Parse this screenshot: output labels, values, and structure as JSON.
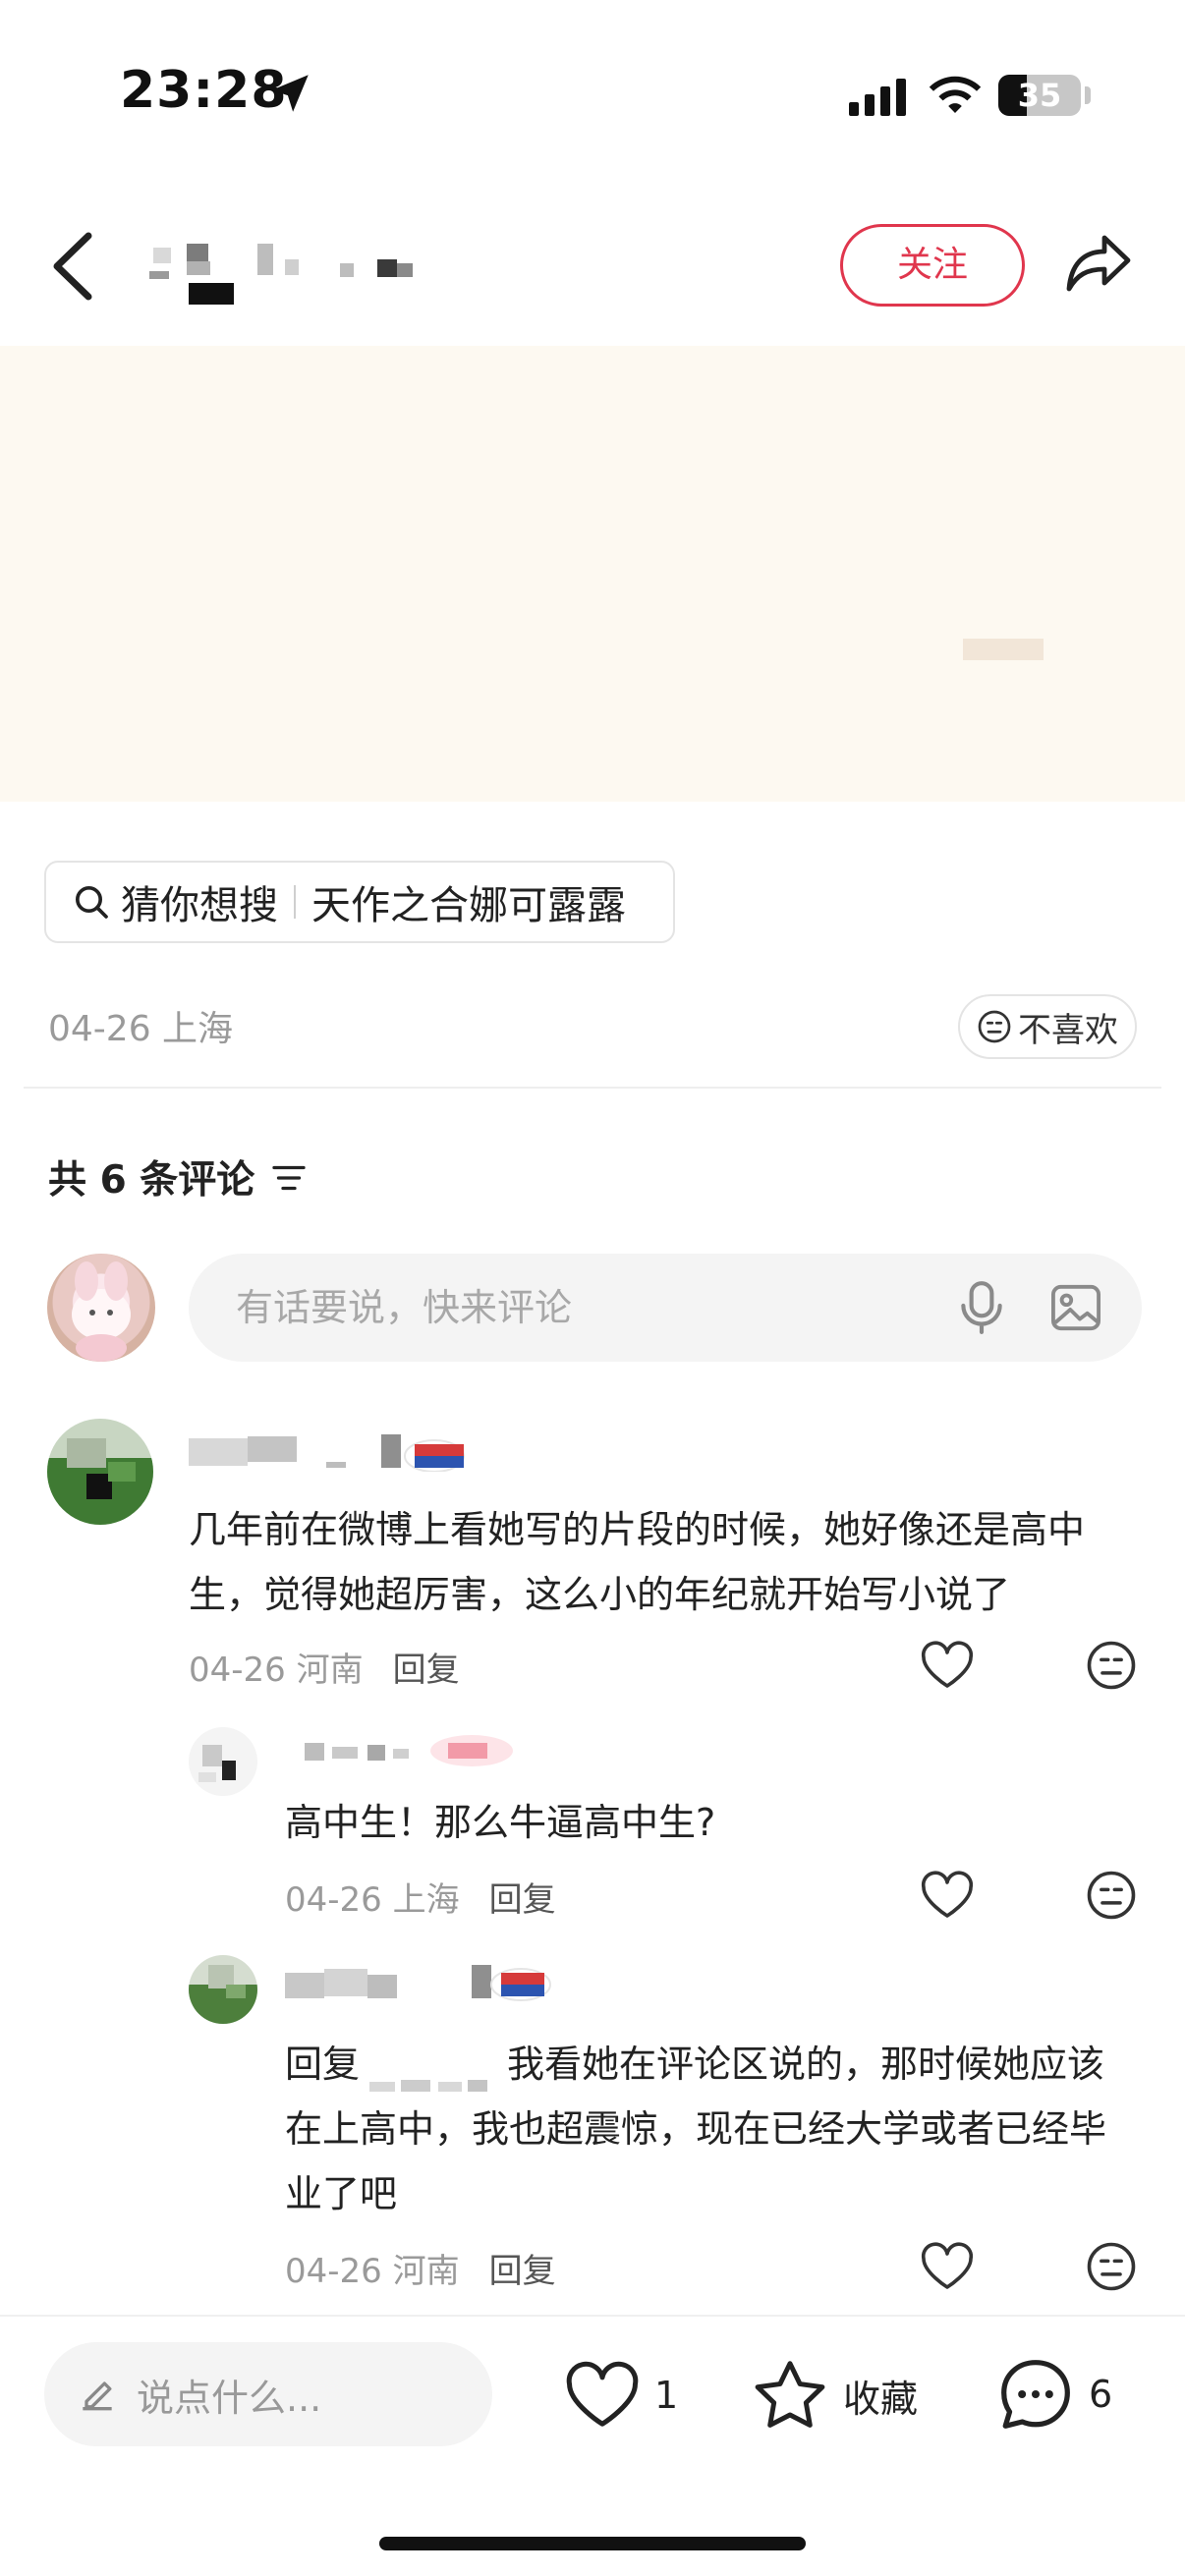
{
  "status_bar": {
    "time": "23:28",
    "battery": "35"
  },
  "header": {
    "follow_label": "关注"
  },
  "search_chip": {
    "prefix": "猜你想搜",
    "query": "天作之合娜可露露"
  },
  "post": {
    "meta": "04-26 上海",
    "dislike_label": "不喜欢"
  },
  "comments_section": {
    "count_label": "共 6 条评论",
    "input_placeholder": "有话要说，快来评论",
    "comments": [
      {
        "text": "几年前在微博上看她写的片段的时候，她好像还是高中生，觉得她超厉害，这么小的年纪就开始写小说了",
        "meta": "04-26 河南",
        "reply_label": "回复"
      },
      {
        "text": "高中生！那么牛逼高中生?",
        "meta": "04-26 上海",
        "reply_label": "回复"
      },
      {
        "text_prefix": "回复",
        "text": "我看她在评论区说的，那时候她应该在上高中，我也超震惊，现在已经大学或者已经毕业了吧",
        "meta": "04-26 河南",
        "reply_label": "回复"
      }
    ]
  },
  "bottom_bar": {
    "input_placeholder": "说点什么...",
    "like_count": "1",
    "collect_label": "收藏",
    "comment_count": "6"
  },
  "colors": {
    "accent": "#e0364d",
    "muted": "#9a9a9a",
    "media_bg": "#fdf9f1"
  }
}
